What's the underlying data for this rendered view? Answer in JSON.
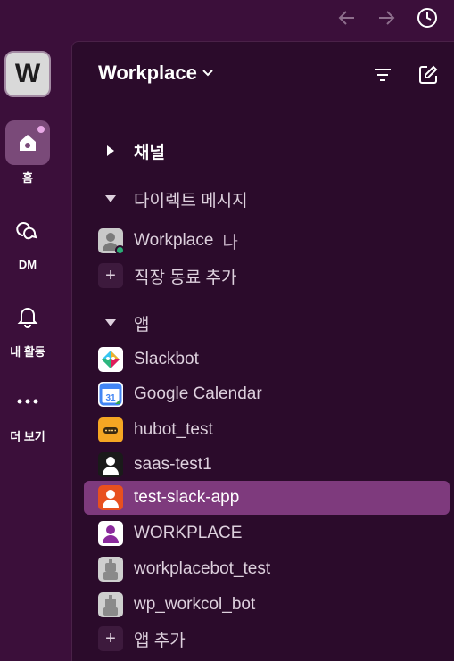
{
  "workspace": {
    "initial": "W",
    "name": "Workplace"
  },
  "rail": {
    "home": "홈",
    "dm": "DM",
    "activity": "내 활동",
    "more": "더 보기"
  },
  "sections": {
    "channels": "채널",
    "direct_messages": "다이렉트 메시지",
    "apps": "앱"
  },
  "dms": {
    "self_name": "Workplace",
    "self_tag": "나",
    "add_coworkers": "직장 동료 추가"
  },
  "apps": [
    {
      "name": "Slackbot",
      "icon": "slackbot-icon"
    },
    {
      "name": "Google Calendar",
      "icon": "google-calendar-icon"
    },
    {
      "name": "hubot_test",
      "icon": "hubot-icon"
    },
    {
      "name": "saas-test1",
      "icon": "person-icon"
    },
    {
      "name": "test-slack-app",
      "icon": "person-icon",
      "selected": true
    },
    {
      "name": "WORKPLACE",
      "icon": "person-icon"
    },
    {
      "name": "workplacebot_test",
      "icon": "robot-icon"
    },
    {
      "name": "wp_workcol_bot",
      "icon": "robot-icon"
    }
  ],
  "add_app": "앱 추가",
  "colors": {
    "background": "#3b0f3a",
    "panel": "#2b0b2b",
    "selected": "#7e3a7d",
    "presence": "#2bac76"
  }
}
